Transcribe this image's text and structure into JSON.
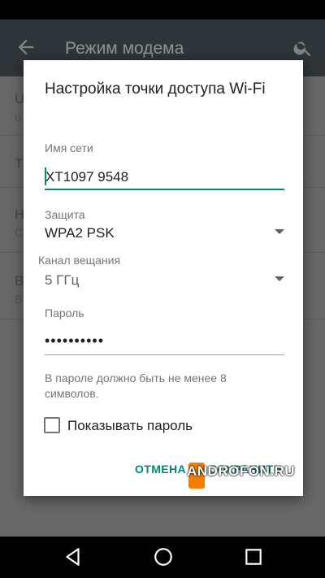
{
  "appbar": {
    "title": "Режим модема"
  },
  "background": {
    "rows": [
      {
        "label": "U",
        "sub": "u"
      },
      {
        "label": "T",
        "sub": ""
      },
      {
        "label": "H",
        "sub": "C"
      },
      {
        "label": "B",
        "sub": "B"
      }
    ]
  },
  "dialog": {
    "title": "Настройка точки доступа Wi-Fi",
    "ssid": {
      "label": "Имя сети",
      "value": "XT1097 9548"
    },
    "security": {
      "label": "Защита",
      "value": "WPA2 PSK"
    },
    "band": {
      "label": "Канал вещания",
      "value": "5 ГГц"
    },
    "password": {
      "label": "Пароль",
      "value": "••••••••••"
    },
    "hint": "В пароле должно быть не менее 8 символов.",
    "show_password": {
      "label": "Показывать пароль",
      "checked": false
    },
    "cancel": "ОТМЕНА",
    "save": "СОХРАНИТЬ"
  },
  "watermark": "ANDROFON.RU",
  "colors": {
    "accent": "#00897b",
    "appbar": "#2f3538",
    "dialog": "#ffffff"
  },
  "icons": [
    "back-arrow-icon",
    "search-icon",
    "dropdown-arrow-icon",
    "checkbox-icon",
    "nav-back-icon",
    "nav-home-icon",
    "nav-recents-icon"
  ]
}
